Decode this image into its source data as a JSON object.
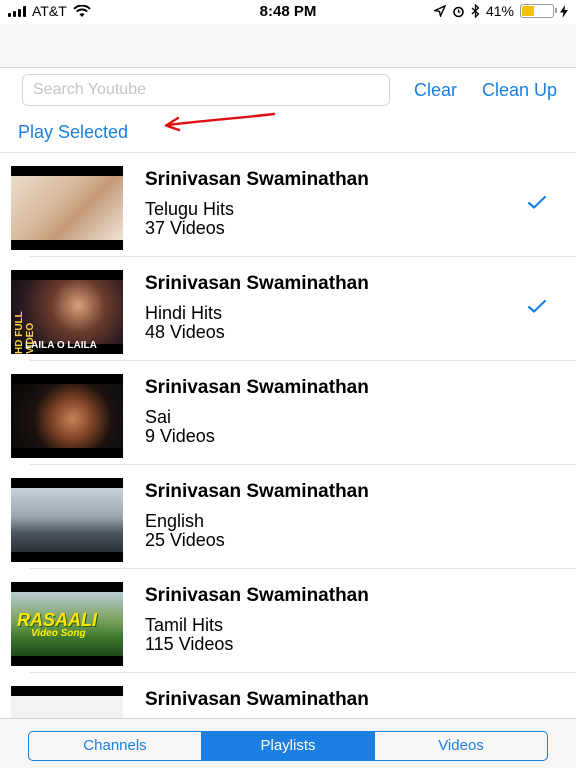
{
  "status_bar": {
    "carrier": "AT&T",
    "time": "8:48 PM",
    "battery": "41%",
    "battery_level": 0.41
  },
  "search": {
    "placeholder": "Search Youtube",
    "value": ""
  },
  "actions": {
    "clear_label": "Clear",
    "cleanup_label": "Clean Up",
    "play_selected_label": "Play Selected"
  },
  "annotation": {
    "arrow_color": "#e01010"
  },
  "accent_color": "#1a7fe0",
  "playlists": [
    {
      "owner": "Srinivasan Swaminathan",
      "title": "Telugu Hits",
      "count": "37 Videos",
      "selected": true
    },
    {
      "owner": "Srinivasan Swaminathan",
      "title": "Hindi Hits",
      "count": "48 Videos",
      "selected": true,
      "thumb_text": "LAILA O LAILA",
      "thumb_badge": "HD FULL VIDEO"
    },
    {
      "owner": "Srinivasan Swaminathan",
      "title": "Sai",
      "count": "9 Videos",
      "selected": false
    },
    {
      "owner": "Srinivasan Swaminathan",
      "title": "English",
      "count": "25 Videos",
      "selected": false
    },
    {
      "owner": "Srinivasan Swaminathan",
      "title": "Tamil Hits",
      "count": "115 Videos",
      "selected": false,
      "thumb_text": "RASAALI",
      "thumb_text2": "Video Song"
    },
    {
      "owner": "Srinivasan Swaminathan",
      "title": "",
      "count": "",
      "selected": false
    }
  ],
  "tabs": [
    {
      "label": "Channels",
      "active": false
    },
    {
      "label": "Playlists",
      "active": true
    },
    {
      "label": "Videos",
      "active": false
    }
  ]
}
